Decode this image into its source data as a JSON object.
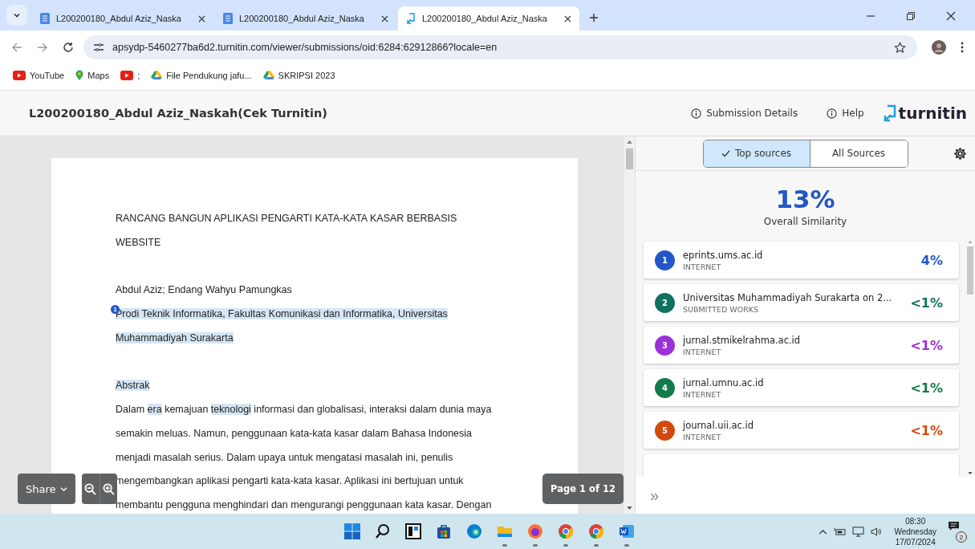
{
  "browser": {
    "tabs": [
      {
        "title": "L200200180_Abdul Aziz_Naska",
        "kind": "docs",
        "selected": false
      },
      {
        "title": "L200200180_Abdul Aziz_Naska",
        "kind": "docs",
        "selected": false
      },
      {
        "title": "L200200180_Abdul Aziz_Naska",
        "kind": "turnitin",
        "selected": true
      }
    ],
    "address": "apsydp-5460277ba6d2.turnitin.com/viewer/submissions/oid:6284:62912866?locale=en",
    "bookmarks": [
      {
        "label": "YouTube",
        "kind": "youtube"
      },
      {
        "label": "Maps",
        "kind": "maps"
      },
      {
        "label": ";",
        "kind": "youtube"
      },
      {
        "label": "File Pendukung jafu...",
        "kind": "drive"
      },
      {
        "label": "SKRIPSI 2023",
        "kind": "drive"
      }
    ]
  },
  "header": {
    "title": "L200200180_Abdul Aziz_Naskah(Cek Turnitin)",
    "links": [
      "Submission Details",
      "Help"
    ],
    "logo": "turnitin"
  },
  "document": {
    "paragraphs": [
      {
        "lines": [
          [
            {
              "text": "RANCANG BANGUN APLIKASI PENGARTI KATA-KATA KASAR BERBASIS",
              "highlight": false
            }
          ],
          [
            {
              "text": "WEBSITE",
              "highlight": false
            }
          ]
        ]
      },
      {
        "marker": "1",
        "lines": [
          [
            {
              "text": "Abdul Aziz; Endang Wahyu Pamungkas",
              "highlight": false
            }
          ],
          [
            {
              "text": "Prodi Teknik Informatika, Fakultas Komunikasi dan Informatika, Universitas",
              "highlight": true
            }
          ],
          [
            {
              "text": "Muhammadiyah Surakarta",
              "highlight": true
            }
          ]
        ]
      },
      {
        "lines": [
          [
            {
              "text": "Abstrak",
              "highlight": true
            }
          ],
          [
            {
              "text": "Dalam ",
              "highlight": false
            },
            {
              "text": "era",
              "highlight": true
            },
            {
              "text": " kemajuan ",
              "highlight": false
            },
            {
              "text": "teknologi",
              "highlight": true
            },
            {
              "text": " informasi dan globalisasi, interaksi dalam dunia maya",
              "highlight": false
            }
          ],
          [
            {
              "text": "semakin meluas. Namun, penggunaan kata-kata kasar dalam Bahasa Indonesia",
              "highlight": false
            }
          ],
          [
            {
              "text": "menjadi masalah serius. Dalam upaya untuk mengatasi masalah ini, penulis",
              "highlight": false
            }
          ],
          [
            {
              "text": "mengembangkan aplikasi pengarti kata-kata kasar. Aplikasi ini bertujuan untuk",
              "highlight": false
            }
          ],
          [
            {
              "text": "membantu pengguna menghindari dan mengurangi penggunaan kata kasar. Dengan",
              "highlight": false
            }
          ]
        ]
      }
    ]
  },
  "viewer": {
    "share": "Share",
    "page": "Page 1 of 12"
  },
  "sources": {
    "tabs": [
      {
        "label": "Top sources",
        "selected": true
      },
      {
        "label": "All Sources",
        "selected": false
      }
    ],
    "similarity": "13%",
    "similarity_label": "Overall Similarity",
    "items": [
      {
        "number": "1",
        "name": "eprints.ums.ac.id",
        "type": "INTERNET",
        "percent": "4%",
        "color": "#2357c8"
      },
      {
        "number": "2",
        "name": "Universitas Muhammadiyah Surakarta on 2...",
        "type": "SUBMITTED WORKS",
        "percent": "<1%",
        "color": "#12705f"
      },
      {
        "number": "3",
        "name": "jurnal.stmikelrahma.ac.id",
        "type": "INTERNET",
        "percent": "<1%",
        "color": "#9b30d9"
      },
      {
        "number": "4",
        "name": "jurnal.umnu.ac.id",
        "type": "INTERNET",
        "percent": "<1%",
        "color": "#137a4a"
      },
      {
        "number": "5",
        "name": "journal.uii.ac.id",
        "type": "INTERNET",
        "percent": "<1%",
        "color": "#d44a0c"
      }
    ],
    "expand": "»"
  },
  "taskbar": {
    "apps": [
      {
        "kind": "windows",
        "running": false
      },
      {
        "kind": "search",
        "running": false
      },
      {
        "kind": "widgets",
        "running": false
      },
      {
        "kind": "store",
        "running": false
      },
      {
        "kind": "edge",
        "running": false
      },
      {
        "kind": "files",
        "running": true
      },
      {
        "kind": "firefox",
        "running": true
      },
      {
        "kind": "chrome",
        "running": true
      },
      {
        "kind": "chrome",
        "running": true
      },
      {
        "kind": "word",
        "running": true
      }
    ],
    "time": "08:30",
    "day": "Wednesday",
    "date": "17/07/2024",
    "notifications": "2"
  }
}
